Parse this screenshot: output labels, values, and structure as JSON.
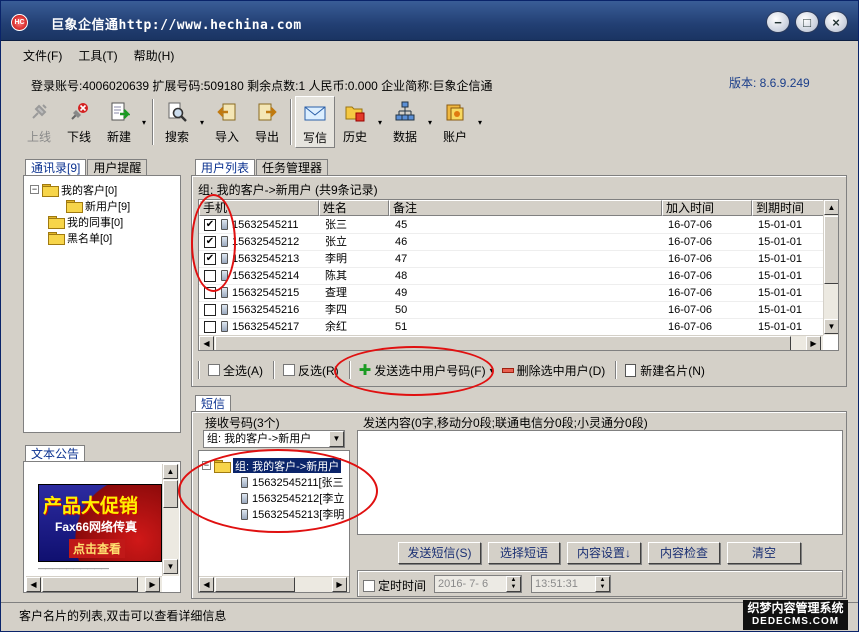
{
  "window": {
    "title": "巨象企信通http://www.hechina.com",
    "app_icon": "HC"
  },
  "title_buttons": {
    "minimize": "−",
    "maximize": "□",
    "close": "×"
  },
  "menu": [
    "文件(F)",
    "工具(T)",
    "帮助(H)"
  ],
  "account": {
    "info": "登录账号:4006020639  扩展号码:509180  剩余点数:1  人民币:0.000  企业简称:巨象企信通",
    "version": "版本: 8.6.9.249"
  },
  "toolbar": {
    "online": "上线",
    "offline": "下线",
    "new": "新建",
    "search": "搜索",
    "import": "导入",
    "export": "导出",
    "compose": "写信",
    "history": "历史",
    "data": "数据",
    "account": "账户",
    "dropdown_arrow": "▾"
  },
  "left_tabs": [
    "通讯录[9]",
    "用户提醒"
  ],
  "tree": {
    "my_clients": "我的客户[0]",
    "new_users": "新用户[9]",
    "my_colleagues": "我的同事[0]",
    "blacklist": "黑名单[0]",
    "expander": "−"
  },
  "announcement": {
    "tab": "文本公告",
    "banner_title": "产品大促销",
    "banner_sub": "Fax66网络传真",
    "banner_btn": "点击查看",
    "dashes": "——————————"
  },
  "right_tabs": [
    "用户列表",
    "任务管理器"
  ],
  "group_header": "组: 我的客户->新用户 (共9条记录)",
  "table": {
    "columns": [
      "手机",
      "姓名",
      "备注",
      "加入时间",
      "到期时间"
    ],
    "rows": [
      {
        "checked": true,
        "check": "✔",
        "phone": "15632545211",
        "name": "张三",
        "note": "45",
        "joined": "16-07-06",
        "expires": "15-01-01"
      },
      {
        "checked": true,
        "check": "✔",
        "phone": "15632545212",
        "name": "张立",
        "note": "46",
        "joined": "16-07-06",
        "expires": "15-01-01"
      },
      {
        "checked": true,
        "check": "✔",
        "phone": "15632545213",
        "name": "李明",
        "note": "47",
        "joined": "16-07-06",
        "expires": "15-01-01"
      },
      {
        "checked": false,
        "check": "",
        "phone": "15632545214",
        "name": "陈其",
        "note": "48",
        "joined": "16-07-06",
        "expires": "15-01-01"
      },
      {
        "checked": false,
        "check": "",
        "phone": "15632545215",
        "name": "查理",
        "note": "49",
        "joined": "16-07-06",
        "expires": "15-01-01"
      },
      {
        "checked": false,
        "check": "",
        "phone": "15632545216",
        "name": "李四",
        "note": "50",
        "joined": "16-07-06",
        "expires": "15-01-01"
      },
      {
        "checked": false,
        "check": "",
        "phone": "15632545217",
        "name": "余红",
        "note": "51",
        "joined": "16-07-06",
        "expires": "15-01-01"
      }
    ]
  },
  "list_actions": {
    "select_all": "全选(A)",
    "invert": "反选(R)",
    "send_selected": "发送选中用户号码(F)",
    "delete_selected": "删除选中用户(D)",
    "new_card": "新建名片(N)"
  },
  "sms": {
    "tab": "短信",
    "recipients_label": "接收号码(3个)",
    "group_select": "组: 我的客户->新用户",
    "tree_group": "组: 我的客户->新用户",
    "recipients": [
      "15632545211[张三",
      "15632545212[李立",
      "15632545213[李明"
    ],
    "content_label": "发送内容(0字,移动分0段;联通电信分0段;小灵通分0段)",
    "send": "发送短信(S)",
    "select_template": "选择短语",
    "content_settings": "内容设置↓",
    "content_check": "内容检查",
    "clear": "清空",
    "scheduled": "定时时间",
    "date": "2016- 7- 6",
    "time": "13:51:31"
  },
  "status": {
    "text": "客户名片的列表,双击可以查看详细信息",
    "watermark_line1": "织梦内容管理系统",
    "watermark_line2": "DEDECMS.COM"
  },
  "scroll": {
    "up": "▲",
    "down": "▼",
    "left": "◀",
    "right": "▶"
  }
}
